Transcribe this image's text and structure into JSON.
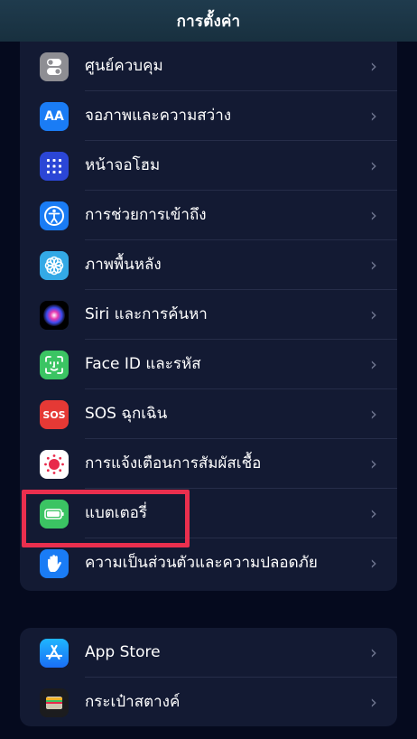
{
  "header": {
    "title": "การตั้งค่า"
  },
  "group1": {
    "items": [
      {
        "label": "ศูนย์ควบคุม",
        "icon": "control-center-icon"
      },
      {
        "label": "จอภาพและความสว่าง",
        "icon": "display-brightness-icon",
        "icon_text": "AA"
      },
      {
        "label": "หน้าจอโฮม",
        "icon": "home-screen-icon"
      },
      {
        "label": "การช่วยการเข้าถึง",
        "icon": "accessibility-icon"
      },
      {
        "label": "ภาพพื้นหลัง",
        "icon": "wallpaper-icon"
      },
      {
        "label": "Siri และการค้นหา",
        "icon": "siri-icon"
      },
      {
        "label": "Face ID และรหัส",
        "icon": "face-id-icon"
      },
      {
        "label": "SOS ฉุกเฉิน",
        "icon": "sos-icon",
        "icon_text": "SOS"
      },
      {
        "label": "การแจ้งเตือนการสัมผัสเชื้อ",
        "icon": "exposure-notification-icon"
      },
      {
        "label": "แบตเตอรี่",
        "icon": "battery-icon"
      },
      {
        "label": "ความเป็นส่วนตัวและความปลอดภัย",
        "icon": "privacy-hand-icon"
      }
    ]
  },
  "group2": {
    "items": [
      {
        "label": "App Store",
        "icon": "app-store-icon"
      },
      {
        "label": "กระเป๋าสตางค์",
        "icon": "wallet-icon"
      }
    ]
  },
  "highlight": {
    "target": "แบตเตอรี่",
    "color": "#ea2f4e"
  }
}
